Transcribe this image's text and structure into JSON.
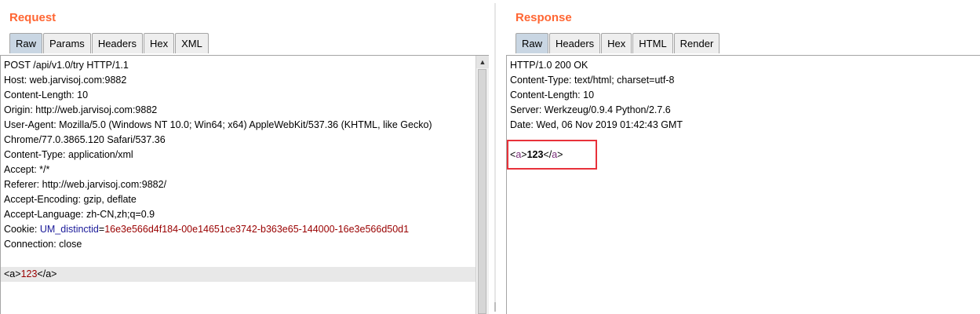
{
  "request": {
    "title": "Request",
    "tabs": [
      "Raw",
      "Params",
      "Headers",
      "Hex",
      "XML"
    ],
    "lines": [
      "POST /api/v1.0/try HTTP/1.1",
      "Host: web.jarvisoj.com:9882",
      "Content-Length: 10",
      "Origin: http://web.jarvisoj.com:9882",
      "User-Agent: Mozilla/5.0 (Windows NT 10.0; Win64; x64) AppleWebKit/537.36 (KHTML, like Gecko)",
      "Chrome/77.0.3865.120 Safari/537.36",
      "Content-Type: application/xml",
      "Accept: */*",
      "Referer: http://web.jarvisoj.com:9882/",
      "Accept-Encoding: gzip, deflate",
      "Accept-Language: zh-CN,zh;q=0.9"
    ],
    "cookie": {
      "label": "Cookie: ",
      "name": "UM_distinctid",
      "eq": "=",
      "value": "16e3e566d4f184-00e14651ce3742-b363e65-144000-16e3e566d50d1"
    },
    "connection": "Connection: close",
    "body": {
      "open": "<a>",
      "value": "123",
      "close": "</a>"
    }
  },
  "response": {
    "title": "Response",
    "tabs": [
      "Raw",
      "Headers",
      "Hex",
      "HTML",
      "Render"
    ],
    "lines": [
      "HTTP/1.0 200 OK",
      "Content-Type: text/html; charset=utf-8",
      "Content-Length: 10",
      "Server: Werkzeug/0.9.4 Python/2.7.6",
      "Date: Wed, 06 Nov 2019 01:42:43 GMT"
    ],
    "body": {
      "lt1": "<",
      "tag1": "a",
      "gt1": ">",
      "value": "123",
      "lt2": "</",
      "tag2": "a",
      "gt2": ">"
    }
  },
  "icons": {
    "scroll_up": "▲"
  },
  "colors": {
    "title": "#ff6633",
    "active_tab": "#c9d6e3",
    "highlight_box": "#e8313a"
  }
}
